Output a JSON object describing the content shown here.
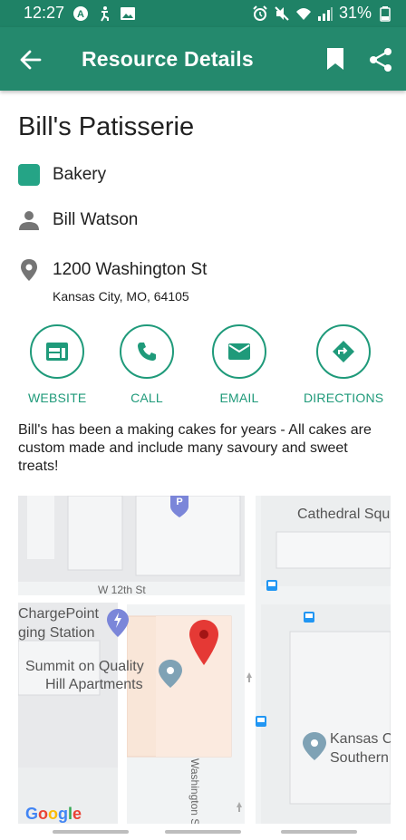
{
  "status_bar": {
    "time": "12:27",
    "battery": "31%",
    "left_icons": [
      "a-icon",
      "accessibility-icon",
      "image-icon"
    ],
    "right_icons": [
      "alarm-icon",
      "mute-icon",
      "wifi-icon",
      "signal-icon",
      "battery-icon"
    ]
  },
  "app_bar": {
    "title": "Resource Details",
    "color": "#24896d"
  },
  "resource": {
    "name": "Bill's Patisserie",
    "category": "Bakery",
    "category_color": "#25a486",
    "contact": "Bill Watson",
    "address_line1": "1200 Washington St",
    "address_line2": "Kansas City, MO, 64105",
    "description": "Bill's has been a making cakes for years - All cakes are custom made and include many savoury and sweet treats!"
  },
  "actions": [
    {
      "label": "WEBSITE",
      "icon": "web-icon"
    },
    {
      "label": "CALL",
      "icon": "phone-icon"
    },
    {
      "label": "EMAIL",
      "icon": "mail-icon"
    },
    {
      "label": "DIRECTIONS",
      "icon": "directions-icon"
    }
  ],
  "map": {
    "labels": {
      "street_w12": "W 12th St",
      "cathedral": "Cathedral Squ",
      "chargepoint_1": "ChargePoint",
      "chargepoint_2": "ging Station",
      "summit_1": "Summit on Quality",
      "summit_2": "Hill Apartments",
      "washington": "Washington St",
      "kansas_1": "Kansas C",
      "kansas_2": "Southern"
    },
    "google": [
      "G",
      "o",
      "o",
      "g",
      "l",
      "e"
    ],
    "google_colors": [
      "#4285f4",
      "#ea4335",
      "#fbbc05",
      "#4285f4",
      "#34a853",
      "#ea4335"
    ],
    "pin_color": "#e53935"
  }
}
